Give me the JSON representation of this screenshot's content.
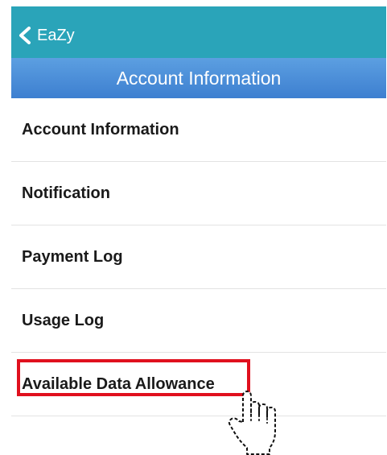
{
  "colors": {
    "top_bar": "#2aa4b9",
    "title_bar": "#4a8cd8",
    "highlight": "#e0101e"
  },
  "nav": {
    "back_label": "EaZy",
    "back_icon": "chevron-left-icon"
  },
  "header": {
    "title": "Account Information"
  },
  "menu": {
    "items": [
      {
        "label": "Account Information"
      },
      {
        "label": "Notification"
      },
      {
        "label": "Payment Log"
      },
      {
        "label": "Usage Log"
      },
      {
        "label": "Available Data Allowance"
      }
    ]
  },
  "annotation": {
    "cursor_icon": "hand-pointer-icon"
  }
}
